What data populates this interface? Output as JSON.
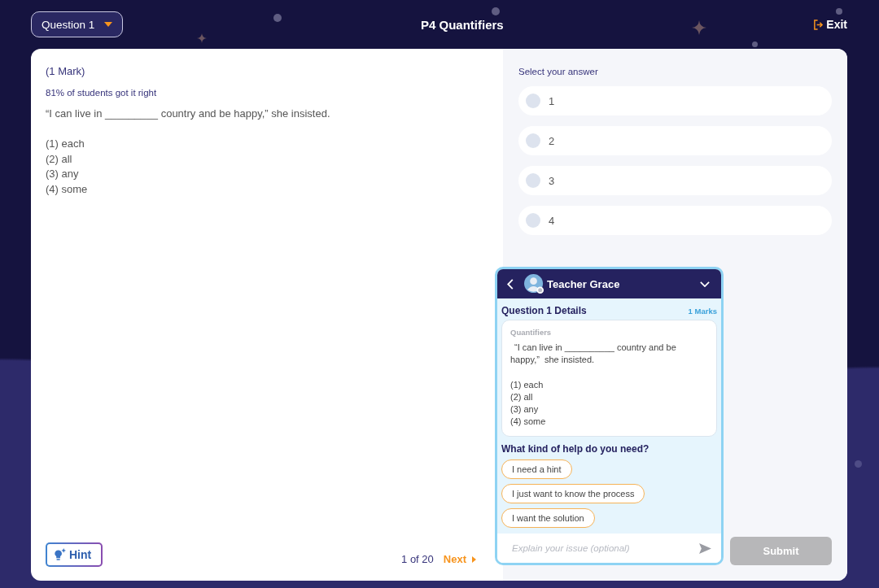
{
  "top_bar": {
    "question_selector": "Question 1",
    "title": "P4 Quantifiers",
    "exit_button": "Exit"
  },
  "question": {
    "marks": "(1 Mark)",
    "success_rate": "81% of students got it right",
    "prompt": "“I can live in _________ country and be happy,” she insisted.",
    "options": [
      "(1) each",
      "(2) all",
      "(3) any",
      "(4) some"
    ]
  },
  "footer": {
    "hint_button": "Hint",
    "page_counter": "1 of 20",
    "next_button": "Next"
  },
  "answers": {
    "heading": "Select your answer",
    "choices": [
      {
        "label": "1",
        "selected": false
      },
      {
        "label": "2",
        "selected": false
      },
      {
        "label": "3",
        "selected": false
      },
      {
        "label": "4",
        "selected": false
      }
    ],
    "submit_button": {
      "label": "Submit",
      "disabled": true
    }
  },
  "chat": {
    "teacher_name": "Teacher Grace",
    "details": {
      "title": "Question 1 Details",
      "marks": "1 Marks",
      "topic": "Quantifiers",
      "prompt": "“I can live in __________ country and be happy,”  she insisted.",
      "options": [
        "(1) each",
        "(2) all",
        "(3) any",
        "(4) some"
      ]
    },
    "help_question": "What kind of help do you need?",
    "help_options": [
      "I need a hint",
      "I just want to know the process",
      "I want the solution"
    ],
    "input": {
      "placeholder": "Explain your issue (optional)"
    }
  }
}
